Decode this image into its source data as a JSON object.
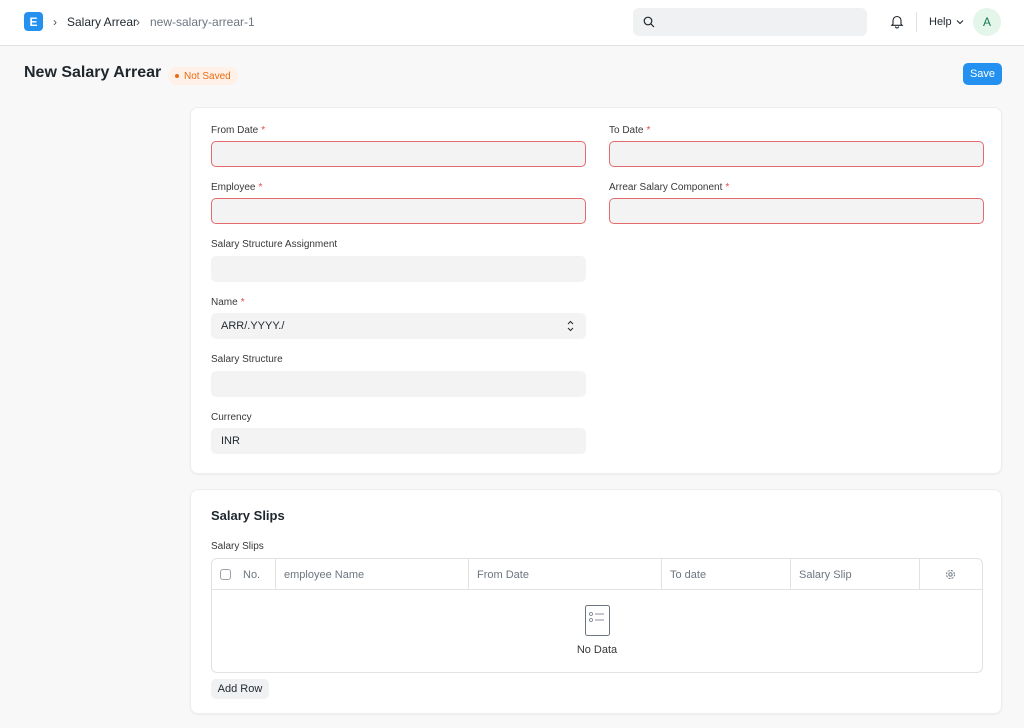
{
  "navbar": {
    "logo_letter": "E",
    "breadcrumbs": [
      "Salary Arrear",
      "new-salary-arrear-1"
    ],
    "help_label": "Help",
    "avatar_initial": "A"
  },
  "page": {
    "title": "New Salary Arrear",
    "status": "Not Saved",
    "save_label": "Save"
  },
  "form": {
    "from_date": {
      "label": "From Date",
      "value": ""
    },
    "to_date": {
      "label": "To Date",
      "value": ""
    },
    "employee": {
      "label": "Employee",
      "value": ""
    },
    "arrear_component": {
      "label": "Arrear Salary Component",
      "value": ""
    },
    "ssa": {
      "label": "Salary Structure Assignment",
      "value": ""
    },
    "name": {
      "label": "Name",
      "value": "ARR/.YYYY./"
    },
    "salary_structure": {
      "label": "Salary Structure",
      "value": ""
    },
    "currency": {
      "label": "Currency",
      "value": "INR"
    }
  },
  "slips": {
    "section_title": "Salary Slips",
    "table_label": "Salary Slips",
    "columns": [
      "No.",
      "employee Name",
      "From Date",
      "To date",
      "Salary Slip"
    ],
    "empty_text": "No Data",
    "add_row_label": "Add Row"
  },
  "colors": {
    "primary": "#2490ef",
    "error": "#e46b6b",
    "warning": "#e86c13"
  }
}
